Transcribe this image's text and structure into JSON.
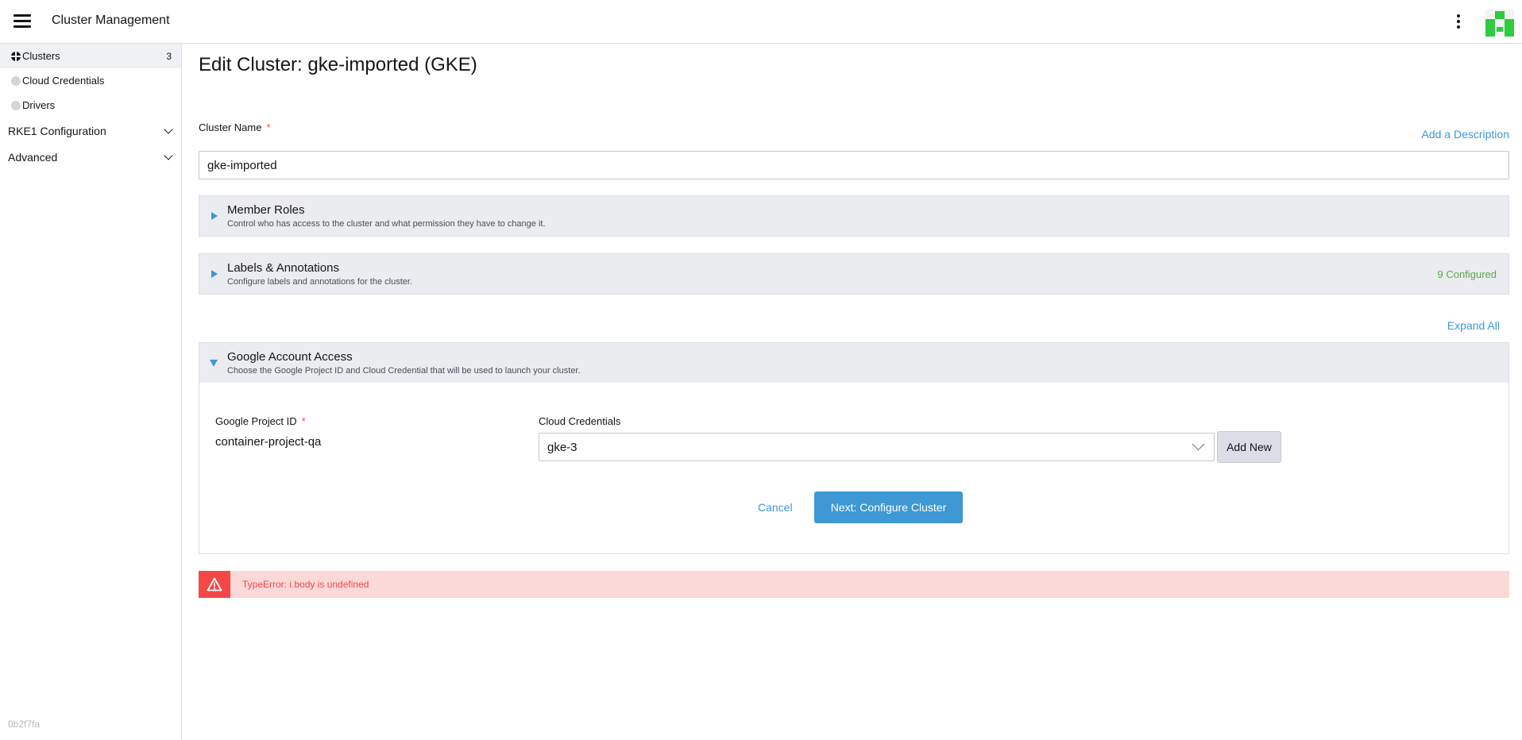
{
  "header": {
    "title": "Cluster Management"
  },
  "sidebar": {
    "items": [
      {
        "label": "Clusters",
        "count": "3"
      },
      {
        "label": "Cloud Credentials"
      },
      {
        "label": "Drivers"
      }
    ],
    "groups": [
      {
        "label": "RKE1 Configuration"
      },
      {
        "label": "Advanced"
      }
    ],
    "version": "0b2f7fa"
  },
  "page": {
    "title": "Edit Cluster: gke-imported (GKE)",
    "cluster_name_label": "Cluster Name",
    "required_mark": "*",
    "add_description": "Add a Description",
    "cluster_name_value": "gke-imported",
    "expand_all": "Expand All"
  },
  "accordions": {
    "member_roles": {
      "title": "Member Roles",
      "description": "Control who has access to the cluster and what permission they have to change it."
    },
    "labels": {
      "title": "Labels & Annotations",
      "description": "Configure labels and annotations for the cluster.",
      "status": "9 Configured"
    },
    "google": {
      "title": "Google Account Access",
      "description": "Choose the Google Project ID and Cloud Credential that will be used to launch your cluster."
    }
  },
  "google_access": {
    "project_id_label": "Google Project ID",
    "project_id_value": "container-project-qa",
    "credentials_label": "Cloud Credentials",
    "credentials_value": "gke-3",
    "add_new": "Add New",
    "cancel": "Cancel",
    "next": "Next: Configure Cluster"
  },
  "error": {
    "message": "TypeError: i.body is undefined"
  },
  "colors": {
    "accent": "#3d98d3",
    "error": "#f64747",
    "success": "#5da74c"
  }
}
